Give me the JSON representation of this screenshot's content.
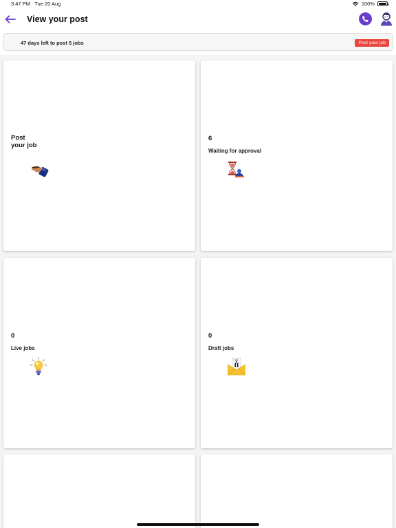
{
  "status_bar": {
    "time": "3:47 PM",
    "date": "Tue 20 Aug",
    "battery": "100%"
  },
  "header": {
    "title": "View your post",
    "back_icon": "arrow-left-icon",
    "phone_icon": "phone-icon",
    "profile_icon": "user-avatar-icon",
    "accent_color": "#6a3bd1"
  },
  "banner": {
    "text": "47 days left to post 5 jobs",
    "button_label": "Post your job",
    "button_color": "#e8453c"
  },
  "cards": [
    {
      "line1": "Post",
      "line2": "your job",
      "icon": "handshake-icon"
    },
    {
      "count": "6",
      "label": "Waiting for approval",
      "icon": "hourglass-icon"
    },
    {
      "count": "0",
      "label": "Live jobs",
      "icon": "lightbulb-icon"
    },
    {
      "count": "0",
      "label": "Draft jobs",
      "icon": "envelope-icon"
    }
  ]
}
